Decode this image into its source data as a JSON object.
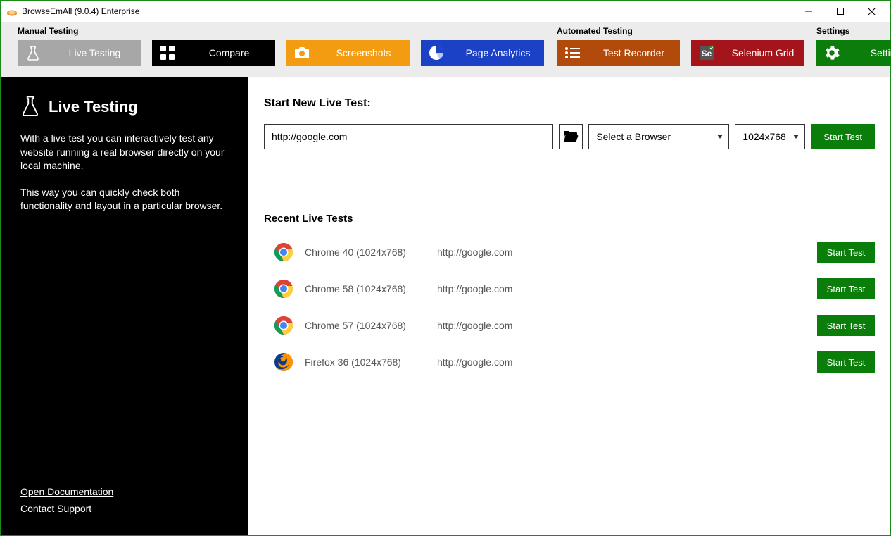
{
  "window": {
    "title": "BrowseEmAll (9.0.4) Enterprise"
  },
  "toolbar": {
    "manual_label": "Manual Testing",
    "automated_label": "Automated Testing",
    "settings_group_label": "Settings",
    "live": "Live Testing",
    "compare": "Compare",
    "screenshots": "Screenshots",
    "analytics": "Page Analytics",
    "recorder": "Test Recorder",
    "selenium": "Selenium Grid",
    "settings": "Settings"
  },
  "sidebar": {
    "title": "Live Testing",
    "p1": "With a live test you can interactively test any website running a real browser directly on your local machine.",
    "p2": "This way you can quickly check both functionality and layout in a particular browser.",
    "link_doc": "Open Documentation",
    "link_support": "Contact Support"
  },
  "new_test": {
    "heading": "Start New Live Test:",
    "url_value": "http://google.com",
    "browser_placeholder": "Select a Browser",
    "resolution_value": "1024x768",
    "start_label": "Start Test"
  },
  "recent": {
    "heading": "Recent Live Tests",
    "start_label": "Start Test",
    "rows": [
      {
        "icon": "chrome",
        "browser": "Chrome 40 (1024x768)",
        "url": "http://google.com"
      },
      {
        "icon": "chrome",
        "browser": "Chrome 58 (1024x768)",
        "url": "http://google.com"
      },
      {
        "icon": "chrome",
        "browser": "Chrome 57 (1024x768)",
        "url": "http://google.com"
      },
      {
        "icon": "firefox",
        "browser": "Firefox 36 (1024x768)",
        "url": "http://google.com"
      }
    ]
  }
}
